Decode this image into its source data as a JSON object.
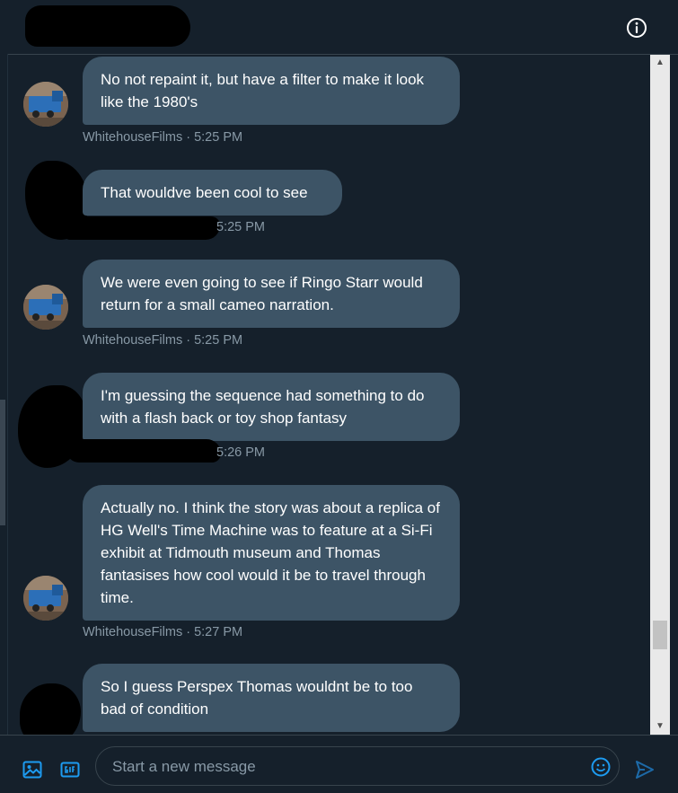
{
  "header": {
    "info_icon": "info-icon"
  },
  "messages": [
    {
      "text": "No not repaint it, but have a filter to make it look like the 1980's",
      "sender": "WhitehouseFilms",
      "time": "WhitehouseFilms · 5:25 PM"
    },
    {
      "text": "That wouldve been cool to see",
      "time": "5:25 PM"
    },
    {
      "text": "We were even going to see if Ringo Starr would return for a small cameo narration.",
      "time": "WhitehouseFilms · 5:25 PM"
    },
    {
      "text": "I'm guessing the sequence had something to do with a flash back or toy shop fantasy",
      "time": "5:26 PM"
    },
    {
      "text": "Actually no. I think the story was about a replica of HG Well's Time Machine was to feature at a Si-Fi exhibit at Tidmouth museum and Thomas fantasises how cool would it be to travel through time.",
      "time": "WhitehouseFilms · 5:27 PM"
    },
    {
      "text": "So I guess Perspex Thomas wouldnt be to too bad of condition"
    }
  ],
  "composer": {
    "placeholder": "Start a new message",
    "icons": [
      "image-icon",
      "gif-icon",
      "emoji-icon",
      "send-icon"
    ]
  },
  "colors": {
    "background": "#15202b",
    "bubble": "#3d5466",
    "meta_text": "#8899a6",
    "accent": "#1d9bf0"
  }
}
